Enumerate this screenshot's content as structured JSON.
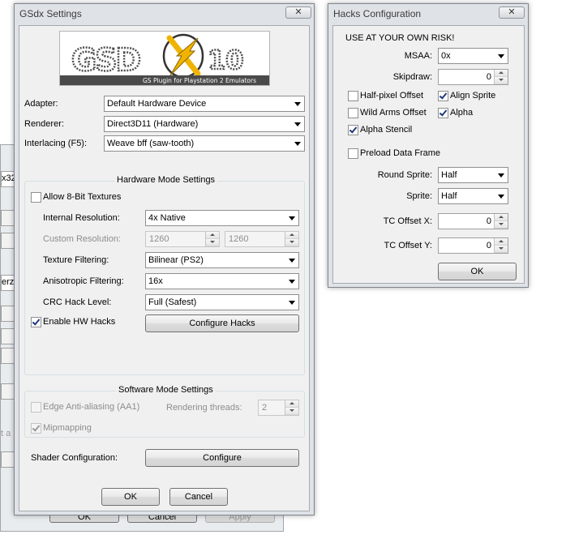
{
  "background_window": {
    "fragments": [
      "x32",
      "erz]",
      "t a"
    ],
    "buttons": [
      "OK",
      "Cancel",
      "Apply"
    ]
  },
  "gsdx": {
    "title": "GSdx Settings",
    "close_glyph": "✕",
    "logo": {
      "main": "GSD",
      "version": "10",
      "tagline": "GS Plugin   for Playstation 2 Emulators"
    },
    "adapter_label": "Adapter:",
    "adapter_value": "Default Hardware Device",
    "renderer_label": "Renderer:",
    "renderer_value": "Direct3D11 (Hardware)",
    "interlacing_label": "Interlacing (F5):",
    "interlacing_value": "Weave bff (saw-tooth)",
    "hw": {
      "title": "Hardware Mode Settings",
      "allow8bit_label": "Allow 8-Bit Textures",
      "allow8bit_checked": false,
      "internal_res_label": "Internal Resolution:",
      "internal_res_value": "4x Native",
      "custom_res_label": "Custom Resolution:",
      "custom_res_w": "1260",
      "custom_res_h": "1260",
      "tex_filter_label": "Texture Filtering:",
      "tex_filter_value": "Bilinear (PS2)",
      "aniso_label": "Anisotropic Filtering:",
      "aniso_value": "16x",
      "crc_label": "CRC Hack Level:",
      "crc_value": "Full (Safest)",
      "hwhacks_label": "Enable HW Hacks",
      "hwhacks_checked": true,
      "configure_hacks_label": "Configure Hacks"
    },
    "sw": {
      "title": "Software Mode Settings",
      "edge_aa_label": "Edge Anti-aliasing (AA1)",
      "threads_label": "Rendering threads:",
      "threads_value": "2",
      "mipmapping_label": "Mipmapping",
      "mipmapping_checked": true
    },
    "shader_label": "Shader Configuration:",
    "configure_label": "Configure",
    "ok_label": "OK",
    "cancel_label": "Cancel"
  },
  "hacks": {
    "title": "Hacks Configuration",
    "close_glyph": "✕",
    "warning": "USE AT YOUR OWN RISK!",
    "msaa_label": "MSAA:",
    "msaa_value": "0x",
    "skipdraw_label": "Skipdraw:",
    "skipdraw_value": "0",
    "half_pixel_label": "Half-pixel Offset",
    "half_pixel_checked": false,
    "align_sprite_label": "Align Sprite",
    "align_sprite_checked": true,
    "wild_arms_label": "Wild Arms Offset",
    "wild_arms_checked": false,
    "alpha_label": "Alpha",
    "alpha_checked": true,
    "alpha_stencil_label": "Alpha Stencil",
    "alpha_stencil_checked": true,
    "preload_label": "Preload Data Frame",
    "preload_checked": false,
    "round_sprite_label": "Round Sprite:",
    "round_sprite_value": "Half",
    "sprite_label": "Sprite:",
    "sprite_value": "Half",
    "tc_x_label": "TC Offset X:",
    "tc_x_value": "0",
    "tc_y_label": "TC Offset Y:",
    "tc_y_value": "0",
    "ok_label": "OK"
  }
}
